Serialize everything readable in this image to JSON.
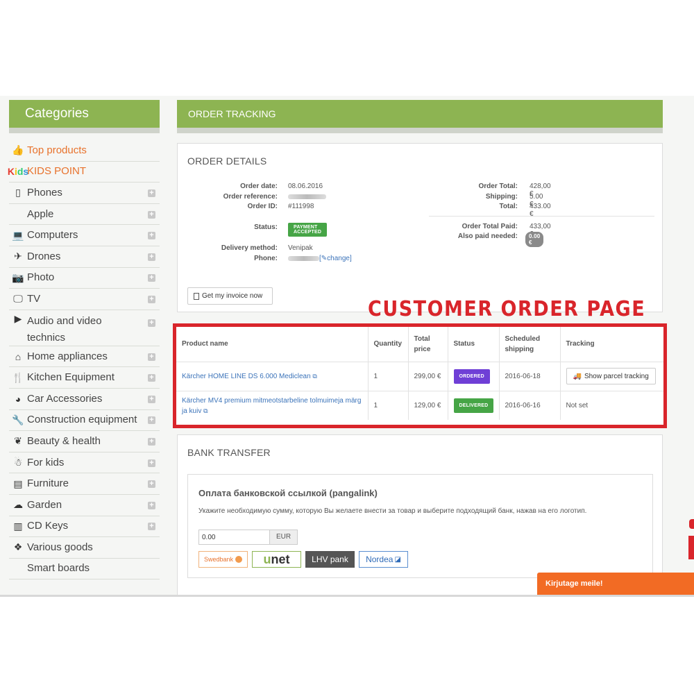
{
  "sidebar": {
    "title": "Categories",
    "items": [
      {
        "label": "Top products",
        "icon": "thumbs-up-icon",
        "glyph": "👍",
        "plus": false
      },
      {
        "label": "KIDS POINT",
        "icon": "kids-point-logo",
        "glyph": "",
        "plus": false
      },
      {
        "label": "Phones",
        "icon": "phone-icon",
        "glyph": "▯",
        "plus": true
      },
      {
        "label": "Apple",
        "icon": "apple-icon",
        "glyph": "",
        "plus": true
      },
      {
        "label": "Computers",
        "icon": "laptop-icon",
        "glyph": "💻",
        "plus": true
      },
      {
        "label": "Drones",
        "icon": "plane-icon",
        "glyph": "✈",
        "plus": true
      },
      {
        "label": "Photo",
        "icon": "camera-icon",
        "glyph": "📷",
        "plus": true
      },
      {
        "label": "TV",
        "icon": "monitor-icon",
        "glyph": "🖵",
        "plus": true
      },
      {
        "label": "Audio and video technics",
        "icon": "play-icon",
        "glyph": "▶",
        "plus": true
      },
      {
        "label": "Home appliances",
        "icon": "home-icon",
        "glyph": "⌂",
        "plus": true
      },
      {
        "label": "Kitchen Equipment",
        "icon": "cutlery-icon",
        "glyph": "🍴",
        "plus": true
      },
      {
        "label": "Car Accessories",
        "icon": "dashboard-icon",
        "glyph": "◕",
        "plus": true
      },
      {
        "label": "Construction equipment",
        "icon": "wrench-icon",
        "glyph": "🔧",
        "plus": true
      },
      {
        "label": "Beauty & health",
        "icon": "leaf-icon",
        "glyph": "❦",
        "plus": true
      },
      {
        "label": "For kids",
        "icon": "child-icon",
        "glyph": "☃",
        "plus": true
      },
      {
        "label": "Furniture",
        "icon": "archive-icon",
        "glyph": "▤",
        "plus": true
      },
      {
        "label": "Garden",
        "icon": "cloud-icon",
        "glyph": "☁",
        "plus": true
      },
      {
        "label": "CD Keys",
        "icon": "barcode-icon",
        "glyph": "▥",
        "plus": true
      },
      {
        "label": "Various goods",
        "icon": "cubes-icon",
        "glyph": "❖",
        "plus": false
      },
      {
        "label": "Smart boards",
        "icon": "",
        "glyph": "",
        "plus": false
      }
    ]
  },
  "header": {
    "title": "ORDER TRACKING"
  },
  "order_details": {
    "title": "ORDER DETAILS",
    "order_date_label": "Order date:",
    "order_date": "08.06.2016",
    "order_reference_label": "Order reference:",
    "order_id_label": "Order ID:",
    "order_id": "#111998",
    "status_label": "Status:",
    "status": "PAYMENT ACCEPTED",
    "delivery_label": "Delivery method:",
    "delivery": "Venipak",
    "phone_label": "Phone:",
    "change_label": "change",
    "order_total_label": "Order Total:",
    "order_total": "428,00 €",
    "shipping_label": "Shipping:",
    "shipping": "5.00 €",
    "total_label": "Total:",
    "total": "433.00 €",
    "paid_label": "Order Total Paid:",
    "paid": "433,00 €",
    "also_paid_label": "Also paid needed:",
    "also_paid": "0.00 €",
    "invoice_button": "Get my invoice now"
  },
  "stamp": "CUSTOMER ORDER PAGE",
  "products": {
    "headers": [
      "Product name",
      "Quantity",
      "Total price",
      "Status",
      "Scheduled shipping",
      "Tracking"
    ],
    "rows": [
      {
        "name": "Kärcher HOME LINE DS 6.000 Mediclean",
        "quantity": "1",
        "price": "299,00 €",
        "status": "ORDERED",
        "status_color": "#6f3fd6",
        "shipping": "2016-06-18",
        "tracking": "Show parcel tracking",
        "tracking_button": true
      },
      {
        "name": "Kärcher MV4 premium mitmeotstarbeline tolmuimeja märg ja kuiv",
        "quantity": "1",
        "price": "129,00 €",
        "status": "DELIVERED",
        "status_color": "#46a546",
        "shipping": "2016-06-16",
        "tracking": "Not set",
        "tracking_button": false
      }
    ]
  },
  "bank_transfer": {
    "title": "BANK TRANSFER",
    "inner_title": "Оплата банковской ссылкой (pangalink)",
    "description": "Укажите необходимую сумму, которую Вы желаете внести за товар и выберите подходящий банк, нажав на его логотип.",
    "amount": "0.00",
    "currency": "EUR",
    "banks": {
      "swedbank": "Swedbank",
      "unet_u": "u",
      "unet_rest": "net",
      "lhv": "LHV pank",
      "nordea": "Nordea"
    }
  },
  "chat": {
    "label": "Kirjutage meile!"
  }
}
